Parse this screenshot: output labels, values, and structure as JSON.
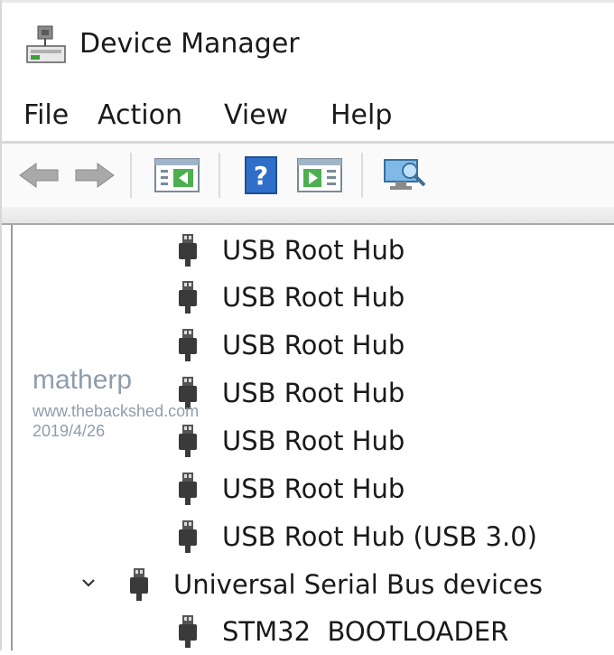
{
  "window": {
    "title": "Device Manager",
    "app_icon": "device-manager-icon"
  },
  "menu": {
    "file": "File",
    "action": "Action",
    "view": "View",
    "help": "Help"
  },
  "toolbar": {
    "buttons": [
      "back-icon",
      "forward-icon",
      "show-hide-console-tree-icon",
      "help-icon",
      "show-hide-action-pane-icon",
      "scan-hardware-icon"
    ]
  },
  "tree": {
    "items": [
      {
        "label": "USB Root Hub",
        "icon": "usb-icon"
      },
      {
        "label": "USB Root Hub",
        "icon": "usb-icon"
      },
      {
        "label": "USB Root Hub",
        "icon": "usb-icon"
      },
      {
        "label": "USB Root Hub",
        "icon": "usb-icon"
      },
      {
        "label": "USB Root Hub",
        "icon": "usb-icon"
      },
      {
        "label": "USB Root Hub",
        "icon": "usb-icon"
      },
      {
        "label": "USB Root Hub (USB 3.0)",
        "icon": "usb-icon"
      },
      {
        "label": "Universal Serial Bus devices",
        "icon": "usb-icon",
        "expanded": true
      },
      {
        "label": "STM32  BOOTLOADER",
        "icon": "usb-icon"
      }
    ]
  },
  "watermark": {
    "name": "matherp",
    "url": "www.thebackshed.com",
    "date": "2019/4/26"
  },
  "colors": {
    "watermark": "#8e9dac",
    "text": "#1a1a1a",
    "usb_icon": "#3a3a3a"
  }
}
